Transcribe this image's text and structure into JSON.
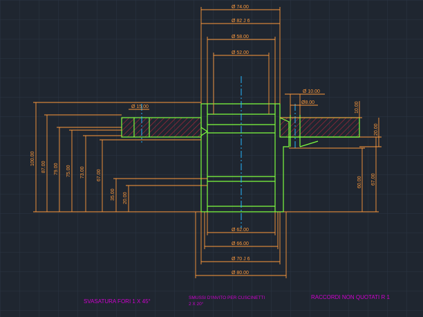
{
  "colors": {
    "background": "#1f2630",
    "grid": "#2b3544",
    "dimension": "#ff9a3c",
    "outline": "#7fff3f",
    "hatch": "#b5263b",
    "centerline": "#26b8ff",
    "note": "#d000d0"
  },
  "dimensions": {
    "top": [
      "Ø 74.00",
      "Ø 82 J 6",
      "Ø 58.00",
      "Ø 52.00"
    ],
    "small_hole": [
      "Ø 10.00",
      "Ø8.00"
    ],
    "hole_left": "Ø 15.00",
    "bottom": [
      "Ø 62.00",
      "Ø 66.00",
      "Ø 70 J 6",
      "Ø 80.00"
    ],
    "left_heights": [
      "100.00",
      "87.00",
      "79.00",
      "75.00",
      "73.00",
      "67.00",
      "35.00",
      "20.00"
    ],
    "right_heights": [
      "10.00",
      "20.00",
      "60.00",
      "67.00"
    ]
  },
  "notes": {
    "chamfer_holes": "SVASATURA FORI   1 X 45°",
    "bearing_chamfer_line1": "SMUSSI D'INVITO PER CUSCINETTI",
    "bearing_chamfer_line2": "2 X 20°",
    "fillets": "RACCORDI NON QUOTATI R 1"
  }
}
